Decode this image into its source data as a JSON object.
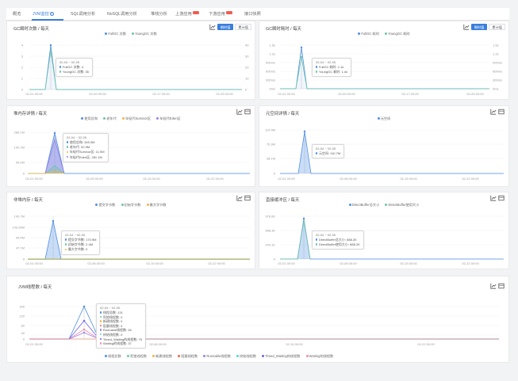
{
  "tabs": [
    {
      "label": "概览"
    },
    {
      "label": "JVM监控",
      "help": "?"
    },
    {
      "label": "SQL调用分析"
    },
    {
      "label": "NoSQL调用分析"
    },
    {
      "label": "堆栈分析"
    },
    {
      "label": "上游应用"
    },
    {
      "label": "下游应用"
    },
    {
      "label": "接口快照"
    }
  ],
  "buttons": {
    "instant": "瞬时值",
    "cumulative": "累计值"
  },
  "icons": {
    "line": "line-chart-icon",
    "table": "data-table-icon"
  },
  "panels": {
    "gc_count": {
      "title": "GC瞬时次数 / 每天",
      "legend": [
        {
          "name": "FullGC 次数",
          "color": "#4f8fe6"
        },
        {
          "name": "YoungGC 次数",
          "color": "#6cc5a8"
        }
      ],
      "y_left": [
        "4",
        "3",
        "2",
        "1",
        "0"
      ],
      "y_right": [
        "40",
        "30",
        "20",
        "10",
        "0"
      ],
      "x_ticks": [
        "02-01 00:00",
        "02-09 00:00",
        "02-17 00:00",
        "02-25 00:00"
      ],
      "tooltip": {
        "date": "02-04 ~ 02-05",
        "rows": [
          {
            "label": "FullGC 次数:",
            "value": "4"
          },
          {
            "label": "YoungGC 次数:",
            "value": "35"
          }
        ]
      }
    },
    "gc_time": {
      "title": "GC瞬时耗时 / 每天",
      "legend": [
        {
          "name": "FullGC 耗时",
          "color": "#4f8fe6"
        },
        {
          "name": "YoungGC 耗时",
          "color": "#6cc5a8"
        }
      ],
      "y_left": [
        "1.5s",
        "1.2s",
        "900ms",
        "600ms",
        "300ms",
        "0ms"
      ],
      "y_right": [
        "1.5s",
        "1.2s",
        "900ms",
        "600ms",
        "300ms",
        "0ms"
      ],
      "x_ticks": [
        "02-01 00:00",
        "02-09 00:00",
        "02-17 00:00",
        "02-25 00:00"
      ],
      "tooltip": {
        "date": "02-04 ~ 02-05",
        "rows": [
          {
            "label": "FullGC 耗时:",
            "value": "1.1s"
          },
          {
            "label": "YoungGC 耗时:",
            "value": "1.4s"
          }
        ]
      }
    },
    "heap": {
      "title": "堆内存详情 / 每天",
      "legend": [
        {
          "name": "使用总和",
          "color": "#4f8fe6"
        },
        {
          "name": "老年代",
          "color": "#6cc5a8"
        },
        {
          "name": "年轻代Survivor区",
          "color": "#f2b544"
        },
        {
          "name": "年轻代Eden区",
          "color": "#9b7fe0"
        }
      ],
      "y_left": [
        "286.1M",
        "190.7M",
        "95.4M",
        "0"
      ],
      "x_ticks": [
        "02-01 00:00",
        "02-09 00:00",
        "02-15 00:00",
        "02-22 00:00"
      ],
      "tooltip": {
        "date": "02-04 ~ 02-05",
        "rows": [
          {
            "label": "使用总和:",
            "value": "345.3M"
          },
          {
            "label": "老年代:",
            "value": "52.9M"
          },
          {
            "label": "年轻代Survivor区:",
            "value": "11.9M"
          },
          {
            "label": "年轻代Eden区:",
            "value": "281.1M"
          }
        ]
      }
    },
    "metaspace": {
      "title": "元空间详情 / 每天",
      "legend": [
        {
          "name": "元空间",
          "color": "#4f8fe6"
        }
      ],
      "y_left": [
        "114.4M",
        "76.3M",
        "38.1M",
        "0"
      ],
      "x_ticks": [
        "02-01 00:00",
        "02-08 00:00",
        "02-15 00:00",
        "02-22 00:00"
      ],
      "tooltip": {
        "date": "02-04 ~ 02-05",
        "rows": [
          {
            "label": "元空间:",
            "value": "110.7M"
          }
        ]
      }
    },
    "nonheap": {
      "title": "非堆内存 / 每天",
      "legend": [
        {
          "name": "提交字节数",
          "color": "#4f8fe6"
        },
        {
          "name": "初始字节数",
          "color": "#6cc5a8"
        },
        {
          "name": "最大字节数",
          "color": "#f2b544"
        }
      ],
      "y_left": [
        "190.7M",
        "143.05M",
        "95.4M",
        "47.7M",
        "0"
      ],
      "x_ticks": [
        "02-01 00:00",
        "02-08 00:00",
        "02-15 00:00",
        "02-22 00:00"
      ],
      "tooltip": {
        "date": "02-04 ~ 02-05",
        "rows": [
          {
            "label": "提交字节数:",
            "value": "170.9M"
          },
          {
            "label": "初始字节数:",
            "value": "2.4M"
          },
          {
            "label": "最大字节数:",
            "value": "0"
          }
        ]
      }
    },
    "direct": {
      "title": "直接缓冲区 / 每天",
      "legend": [
        {
          "name": "DirectBuffer总大小",
          "color": "#4f8fe6"
        },
        {
          "name": "DirectBuffer使用大小",
          "color": "#6cc5a8"
        }
      ],
      "y_left": [
        "976.6K",
        "488.3K",
        "244.1K",
        "0"
      ],
      "x_ticks": [
        "02-01 00:00",
        "02-08 00:00",
        "02-15 00:00",
        "02-22 00:00"
      ],
      "tooltip": {
        "date": "02-04 ~ 02-05",
        "rows": [
          {
            "label": "DirectBuffer总大小:",
            "value": "888.2K"
          },
          {
            "label": "DirectBuffer使用大小:",
            "value": "888.2K"
          }
        ]
      }
    },
    "threads": {
      "title": "JVM线程数 / 每天",
      "legend": [
        {
          "name": "线程总数",
          "color": "#4f8fe6"
        },
        {
          "name": "死锁线程数",
          "color": "#6cc5a8"
        },
        {
          "name": "新建线程数",
          "color": "#f2b544"
        },
        {
          "name": "阻塞线程数",
          "color": "#e8684a"
        },
        {
          "name": "Runnable线程数",
          "color": "#9b7fe0"
        },
        {
          "name": "终结线程数",
          "color": "#5ad8d0"
        },
        {
          "name": "Timed_Waiting的线程数",
          "color": "#6f5ef9"
        },
        {
          "name": "Waiting的线程数",
          "color": "#f08bb4"
        }
      ],
      "y_left": [
        "160",
        "120",
        "80",
        "40",
        "0"
      ],
      "x_ticks": [
        "02-01 00:00",
        "02-08 00:00",
        "02-15 00:00",
        "02-22 00:00"
      ],
      "tooltip": {
        "date": "02-04 ~ 02-05",
        "rows": [
          {
            "label": "线程总数:",
            "value": "131"
          },
          {
            "label": "死锁线程数:",
            "value": "0"
          },
          {
            "label": "新建线程数:",
            "value": "0"
          },
          {
            "label": "阻塞线程数:",
            "value": "0"
          },
          {
            "label": "Runnable线程数:",
            "value": "26"
          },
          {
            "label": "终结线程数:",
            "value": "0"
          },
          {
            "label": "Timed_Waiting的线程数:",
            "value": "75"
          },
          {
            "label": "Waiting的线程数:",
            "value": "37"
          }
        ]
      }
    }
  },
  "chart_data": [
    {
      "type": "line",
      "title": "GC瞬时次数 / 每天",
      "x": [
        "02-04 ~ 02-05"
      ],
      "series": [
        {
          "name": "FullGC 次数",
          "values": [
            4
          ]
        },
        {
          "name": "YoungGC 次数",
          "values": [
            35
          ]
        }
      ]
    },
    {
      "type": "line",
      "title": "GC瞬时耗时 / 每天",
      "x": [
        "02-04 ~ 02-05"
      ],
      "series": [
        {
          "name": "FullGC 耗时",
          "values": [
            1.1
          ]
        },
        {
          "name": "YoungGC 耗时",
          "values": [
            1.4
          ]
        }
      ]
    },
    {
      "type": "area",
      "title": "堆内存详情 / 每天",
      "x": [
        "02-04 ~ 02-05"
      ],
      "series": [
        {
          "name": "使用总和",
          "values": [
            345.3
          ]
        },
        {
          "name": "老年代",
          "values": [
            52.9
          ]
        },
        {
          "name": "年轻代Survivor区",
          "values": [
            11.9
          ]
        },
        {
          "name": "年轻代Eden区",
          "values": [
            281.1
          ]
        }
      ]
    },
    {
      "type": "area",
      "title": "元空间详情 / 每天",
      "x": [
        "02-04 ~ 02-05"
      ],
      "series": [
        {
          "name": "元空间",
          "values": [
            110.7
          ]
        }
      ]
    },
    {
      "type": "area",
      "title": "非堆内存 / 每天",
      "x": [
        "02-04 ~ 02-05"
      ],
      "series": [
        {
          "name": "提交字节数",
          "values": [
            170.9
          ]
        },
        {
          "name": "初始字节数",
          "values": [
            2.4
          ]
        },
        {
          "name": "最大字节数",
          "values": [
            0
          ]
        }
      ]
    },
    {
      "type": "area",
      "title": "直接缓冲区 / 每天",
      "x": [
        "02-04 ~ 02-05"
      ],
      "series": [
        {
          "name": "DirectBuffer总大小",
          "values": [
            888.2
          ]
        },
        {
          "name": "DirectBuffer使用大小",
          "values": [
            888.2
          ]
        }
      ]
    },
    {
      "type": "line",
      "title": "JVM线程数 / 每天",
      "x": [
        "02-04 ~ 02-05"
      ],
      "series": [
        {
          "name": "线程总数",
          "values": [
            131
          ]
        },
        {
          "name": "死锁线程数",
          "values": [
            0
          ]
        },
        {
          "name": "新建线程数",
          "values": [
            0
          ]
        },
        {
          "name": "阻塞线程数",
          "values": [
            0
          ]
        },
        {
          "name": "Runnable线程数",
          "values": [
            26
          ]
        },
        {
          "name": "终结线程数",
          "values": [
            0
          ]
        },
        {
          "name": "Timed_Waiting的线程数",
          "values": [
            75
          ]
        },
        {
          "name": "Waiting的线程数",
          "values": [
            37
          ]
        }
      ]
    }
  ]
}
